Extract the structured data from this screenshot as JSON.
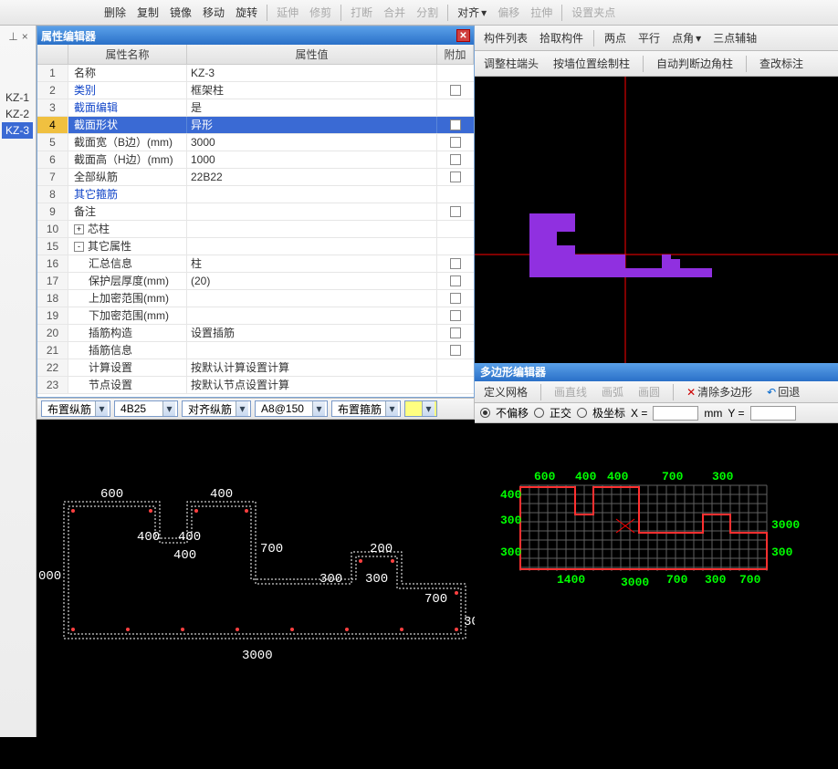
{
  "top_toolbar": {
    "delete": "删除",
    "copy": "复制",
    "mirror": "镜像",
    "move": "移动",
    "rotate": "旋转",
    "extend": "延伸",
    "trim": "修剪",
    "break": "打断",
    "merge": "合并",
    "split": "分割",
    "align": "对齐",
    "offset": "偏移",
    "stretch": "拉伸",
    "setgrip": "设置夹点"
  },
  "toolbar2": {
    "component_list": "构件列表",
    "pick_component": "拾取构件",
    "two_point": "两点",
    "parallel": "平行",
    "point_angle": "点角",
    "three_point": "三点辅轴"
  },
  "toolbar3": {
    "adjust_end": "调整柱端头",
    "by_wall": "按墙位置绘制柱",
    "auto_judge": "自动判断边角柱",
    "view_mark": "查改标注"
  },
  "prop_editor": {
    "title": "属性编辑器",
    "headers": {
      "name": "属性名称",
      "value": "属性值",
      "add": "附加"
    },
    "rows": [
      {
        "n": "1",
        "name": "名称",
        "val": "KZ-3",
        "blue": false,
        "chk": false
      },
      {
        "n": "2",
        "name": "类别",
        "val": "框架柱",
        "blue": true,
        "chk": true
      },
      {
        "n": "3",
        "name": "截面编辑",
        "val": "是",
        "blue": true,
        "chk": false
      },
      {
        "n": "4",
        "name": "截面形状",
        "val": "异形",
        "blue": true,
        "chk": true,
        "sel": true
      },
      {
        "n": "5",
        "name": "截面宽（B边）(mm)",
        "val": "3000",
        "blue": false,
        "chk": true
      },
      {
        "n": "6",
        "name": "截面高（H边）(mm)",
        "val": "1000",
        "blue": false,
        "chk": true
      },
      {
        "n": "7",
        "name": "全部纵筋",
        "val": "22B22",
        "blue": false,
        "chk": true
      },
      {
        "n": "8",
        "name": "其它箍筋",
        "val": "",
        "blue": true,
        "chk": false
      },
      {
        "n": "9",
        "name": "备注",
        "val": "",
        "blue": false,
        "chk": true
      },
      {
        "n": "10",
        "name": "芯柱",
        "val": "",
        "blue": false,
        "chk": false,
        "exp": "+"
      },
      {
        "n": "15",
        "name": "其它属性",
        "val": "",
        "blue": false,
        "chk": false,
        "exp": "-"
      },
      {
        "n": "16",
        "name": "汇总信息",
        "val": "柱",
        "blue": false,
        "chk": true,
        "indent": 1
      },
      {
        "n": "17",
        "name": "保护层厚度(mm)",
        "val": "(20)",
        "blue": false,
        "chk": true,
        "indent": 1
      },
      {
        "n": "18",
        "name": "上加密范围(mm)",
        "val": "",
        "blue": false,
        "chk": true,
        "indent": 1
      },
      {
        "n": "19",
        "name": "下加密范围(mm)",
        "val": "",
        "blue": false,
        "chk": true,
        "indent": 1
      },
      {
        "n": "20",
        "name": "插筋构造",
        "val": "设置插筋",
        "blue": false,
        "chk": true,
        "indent": 1
      },
      {
        "n": "21",
        "name": "插筋信息",
        "val": "",
        "blue": false,
        "chk": true,
        "indent": 1
      },
      {
        "n": "22",
        "name": "计算设置",
        "val": "按默认计算设置计算",
        "blue": false,
        "chk": false,
        "indent": 1
      },
      {
        "n": "23",
        "name": "节点设置",
        "val": "按默认节点设置计算",
        "blue": false,
        "chk": false,
        "indent": 1
      }
    ]
  },
  "rebar_bar": {
    "layout_v": "布置纵筋",
    "v_val": "4B25",
    "align_v": "对齐纵筋",
    "a_val": "A8@150",
    "layout_h": "布置箍筋"
  },
  "kz_list": [
    "KZ-1",
    "KZ-2",
    "KZ-3"
  ],
  "kz_sel": 2,
  "poly": {
    "title": "多边形编辑器",
    "def_grid": "定义网格",
    "line": "画直线",
    "arc": "画弧",
    "circle": "画圆",
    "clear": "清除多边形",
    "back": "回退",
    "no_off": "不偏移",
    "ortho": "正交",
    "polar": "极坐标",
    "x": "X =",
    "y": "Y =",
    "mm": "mm"
  },
  "left_canvas_dims": {
    "top": [
      "600",
      "400"
    ],
    "mid": [
      "400",
      "400",
      "700",
      "200"
    ],
    "mid2": [
      "400",
      "300",
      "300",
      "700"
    ],
    "left": "000",
    "right": "30",
    "bottom": "3000"
  },
  "poly_canvas_dims": {
    "top": [
      "600",
      "400",
      "400",
      "700",
      "300"
    ],
    "left": [
      "400",
      "300",
      "300"
    ],
    "right": [
      "3000",
      "300"
    ],
    "bottom": [
      "1400",
      "3000",
      "700",
      "300",
      "700"
    ]
  }
}
